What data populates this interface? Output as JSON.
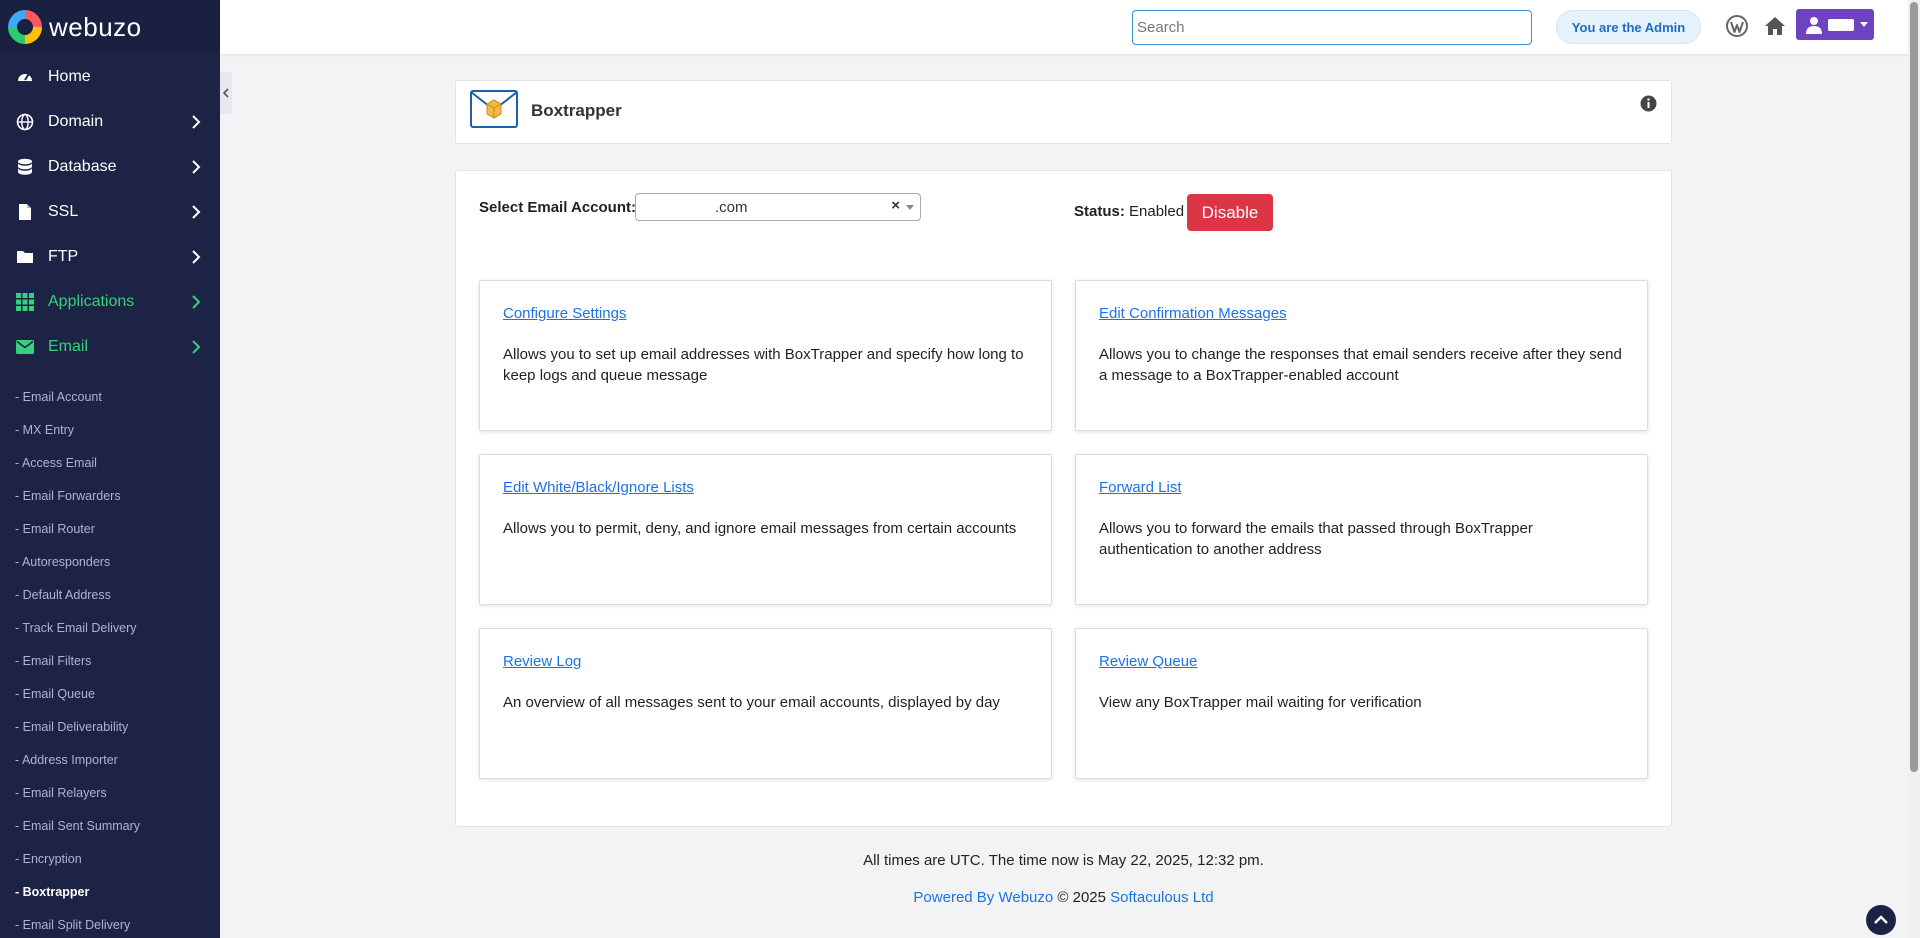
{
  "brand": {
    "name": "webuzo"
  },
  "sidebar": {
    "nav": [
      {
        "label": "Home",
        "icon": "dashboard-icon",
        "chevron": false,
        "green": false
      },
      {
        "label": "Domain",
        "icon": "globe-icon",
        "chevron": true,
        "green": false
      },
      {
        "label": "Database",
        "icon": "database-icon",
        "chevron": true,
        "green": false
      },
      {
        "label": "SSL",
        "icon": "file-icon",
        "chevron": true,
        "green": false
      },
      {
        "label": "FTP",
        "icon": "folder-icon",
        "chevron": true,
        "green": false
      },
      {
        "label": "Applications",
        "icon": "grid-icon",
        "chevron": true,
        "green": true
      },
      {
        "label": "Email",
        "icon": "envelope-icon",
        "chevron": true,
        "green": true
      }
    ],
    "email_sub": [
      "- Email Account",
      "- MX Entry",
      "- Access Email",
      "- Email Forwarders",
      "- Email Router",
      "- Autoresponders",
      "- Default Address",
      "- Track Email Delivery",
      "- Email Filters",
      "- Email Queue",
      "- Email Deliverability",
      "- Address Importer",
      "- Email Relayers",
      "- Email Sent Summary",
      "- Encryption",
      "- Boxtrapper",
      "- Email Split Delivery"
    ],
    "active_sub": "- Boxtrapper"
  },
  "topbar": {
    "search_placeholder": "Search",
    "admin_label": "You are the Admin"
  },
  "page": {
    "title": "Boxtrapper",
    "select_label": "Select Email Account:",
    "select_value": ".com",
    "select_clear": "×",
    "status_label": "Status:",
    "status_value": "Enabled",
    "disable_label": "Disable"
  },
  "tiles": [
    {
      "link": "Configure Settings",
      "desc": "Allows you to set up email addresses with BoxTrapper and specify how long to keep logs and queue message"
    },
    {
      "link": "Edit Confirmation Messages",
      "desc": "Allows you to change the responses that email senders receive after they send a message to a BoxTrapper-enabled account"
    },
    {
      "link": "Edit White/Black/Ignore Lists",
      "desc": "Allows you to permit, deny, and ignore email messages from certain accounts"
    },
    {
      "link": "Forward List",
      "desc": "Allows you to forward the emails that passed through BoxTrapper authentication to another address"
    },
    {
      "link": "Review Log",
      "desc": "An overview of all messages sent to your email accounts, displayed by day"
    },
    {
      "link": "Review Queue",
      "desc": "View any BoxTrapper mail waiting for verification"
    }
  ],
  "footer": {
    "time_text": "All times are UTC. The time now is May 22, 2025, 12:32 pm.",
    "powered_link": "Powered By Webuzo",
    "copyright": " © 2025 ",
    "company_link": "Softaculous Ltd"
  },
  "colors": {
    "sidebar_bg": "#1d2345",
    "accent_green": "#35d07f",
    "link_blue": "#1a73e8",
    "danger": "#dc3545",
    "user_purple": "#6f42c1"
  }
}
